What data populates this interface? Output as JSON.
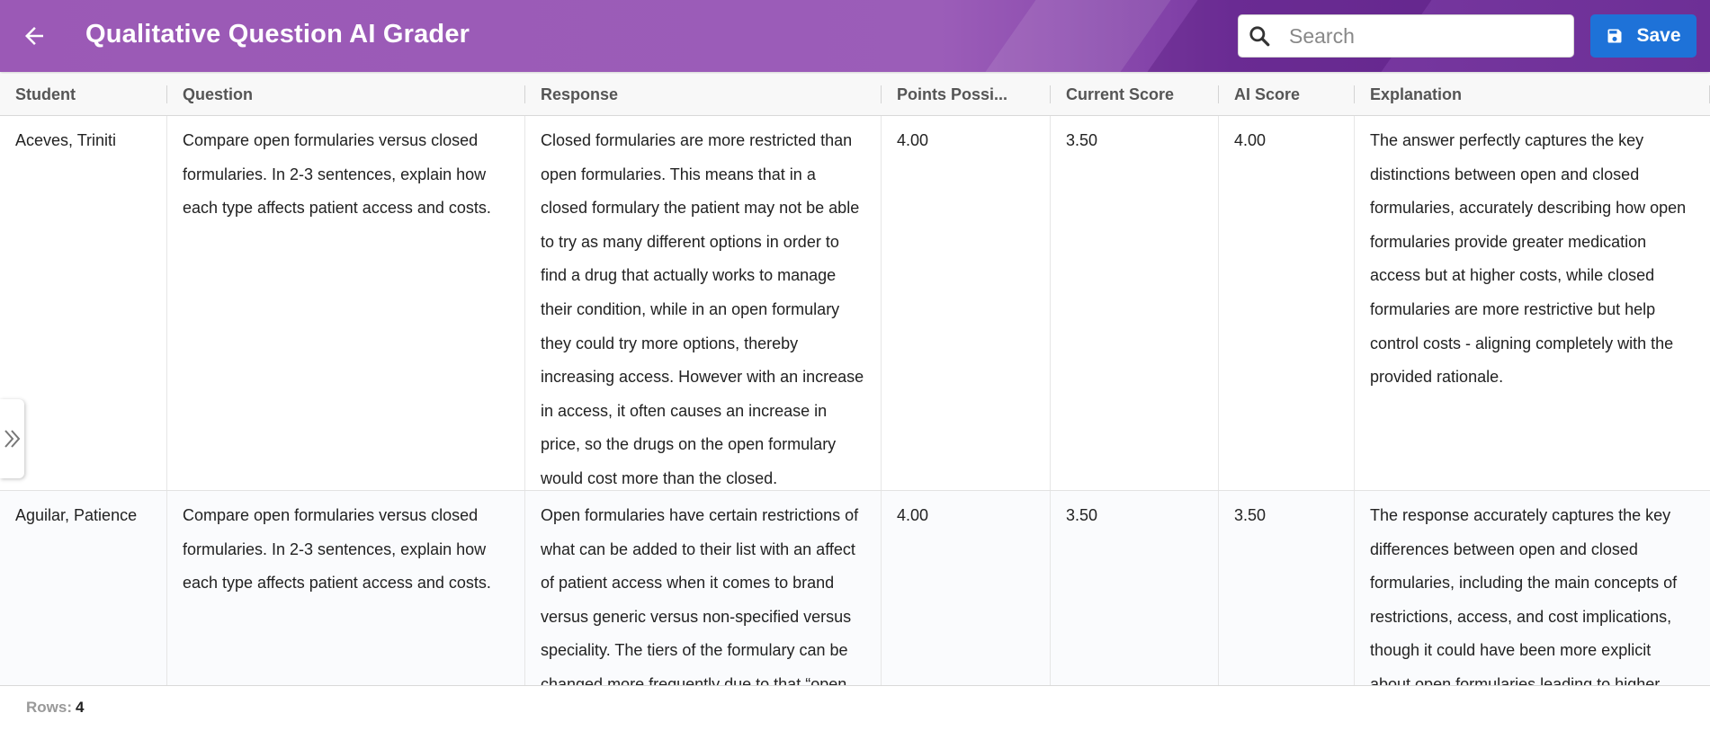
{
  "header": {
    "title": "Qualitative Question AI Grader",
    "back_icon": "arrow-left-icon",
    "search": {
      "placeholder": "Search",
      "value": "",
      "icon": "search-icon"
    },
    "save_label": "Save",
    "save_icon": "floppy-disk-icon",
    "colors": {
      "bar": "#9b59b6",
      "save_button": "#1e72d8"
    }
  },
  "table": {
    "columns": [
      "Student",
      "Question",
      "Response",
      "Points Possi...",
      "Current Score",
      "AI Score",
      "Explanation"
    ],
    "rows": [
      {
        "student": "Aceves, Triniti",
        "question": "Compare open formularies versus closed formularies. In 2-3 sentences, explain how each type affects patient access and costs.",
        "response": "Closed formularies are more restricted than open formularies. This means that in a closed formulary the patient may not be able to try as many different options in order to find a drug that actually works to manage their condition, while in an open formulary they could try more options, thereby increasing access. However with an increase in access, it often causes an increase in price, so the drugs on the open formulary would cost more than the closed.",
        "points_possible": "4.00",
        "current_score": "3.50",
        "ai_score": "4.00",
        "explanation": "The answer perfectly captures the key distinctions between open and closed formularies, accurately describing how open formularies provide greater medication access but at higher costs, while closed formularies are more restrictive but help control costs - aligning completely with the provided rationale."
      },
      {
        "student": "Aguilar, Patience",
        "question": "Compare open formularies versus closed formularies. In 2-3 sentences, explain how each type affects patient access and costs.",
        "response": "Open formularies have certain restrictions of what can be added to their list with an affect of patient access when it comes to brand versus generic versus non-specified versus speciality. The tiers of the formulary can be changed more frequently due to that “open",
        "points_possible": "4.00",
        "current_score": "3.50",
        "ai_score": "3.50",
        "explanation": "The response accurately captures the key differences between open and closed formularies, including the main concepts of restrictions, access, and cost implications, though it could have been more explicit about open formularies leading to higher"
      }
    ]
  },
  "side_panel": {
    "expand_icon": "double-chevron-right-icon"
  },
  "footer": {
    "rows_label": "Rows:",
    "rows_count": "4"
  }
}
